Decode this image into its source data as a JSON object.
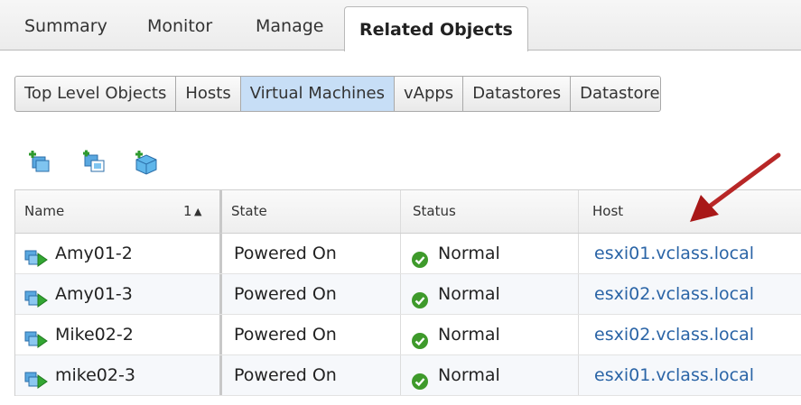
{
  "tabs": [
    "Summary",
    "Monitor",
    "Manage",
    "Related Objects"
  ],
  "active_tab": "Related Objects",
  "subtabs": [
    "Top Level Objects",
    "Hosts",
    "Virtual Machines",
    "vApps",
    "Datastores",
    "Datastore"
  ],
  "active_subtab": "Virtual Machines",
  "toolbar_icons": [
    "new-vm-icon",
    "clone-vm-icon",
    "deploy-ovf-icon"
  ],
  "grid": {
    "columns": [
      "Name",
      "State",
      "Status",
      "Host"
    ],
    "sort": {
      "column": "Name",
      "order_label": "1",
      "direction": "ascending"
    },
    "rows": [
      {
        "name": "Amy01-2",
        "state": "Powered On",
        "status": "Normal",
        "host": "esxi01.vclass.local"
      },
      {
        "name": "Amy01-3",
        "state": "Powered On",
        "status": "Normal",
        "host": "esxi02.vclass.local"
      },
      {
        "name": "Mike02-2",
        "state": "Powered On",
        "status": "Normal",
        "host": "esxi02.vclass.local"
      },
      {
        "name": "mike02-3",
        "state": "Powered On",
        "status": "Normal",
        "host": "esxi01.vclass.local"
      }
    ]
  },
  "colors": {
    "accent": "#c7def6",
    "link": "#2a64a6",
    "ok": "#3e9a2b",
    "annotation_arrow": "#b21e1e"
  }
}
